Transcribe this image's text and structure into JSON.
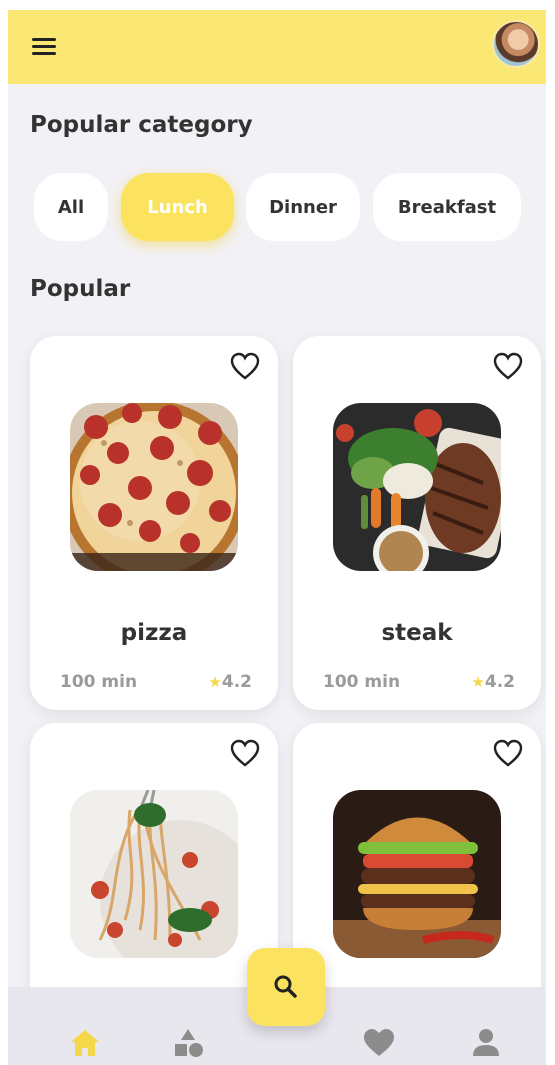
{
  "header": {
    "menu_icon": "menu-icon",
    "avatar": "user-avatar"
  },
  "category_section": {
    "title": "Popular category",
    "chips": [
      {
        "label": "All",
        "active": false
      },
      {
        "label": "Lunch",
        "active": true
      },
      {
        "label": "Dinner",
        "active": false
      },
      {
        "label": "Breakfast",
        "active": false
      }
    ]
  },
  "popular_section": {
    "title": "Popular",
    "items": [
      {
        "name": "pizza",
        "time": "100 min",
        "rating": "4.2"
      },
      {
        "name": "steak",
        "time": "100 min",
        "rating": "4.2"
      },
      {
        "name": "",
        "time": "",
        "rating": ""
      },
      {
        "name": "",
        "time": "",
        "rating": ""
      }
    ]
  },
  "bottom_nav": {
    "items": [
      "home-icon",
      "categories-icon",
      "favorites-icon",
      "profile-icon"
    ],
    "active": "home-icon",
    "fab": "search-icon"
  },
  "colors": {
    "accent": "#fbe35f",
    "appbar": "#fbe773",
    "background": "#f2f1f6",
    "active_nav": "#f4d84a"
  }
}
